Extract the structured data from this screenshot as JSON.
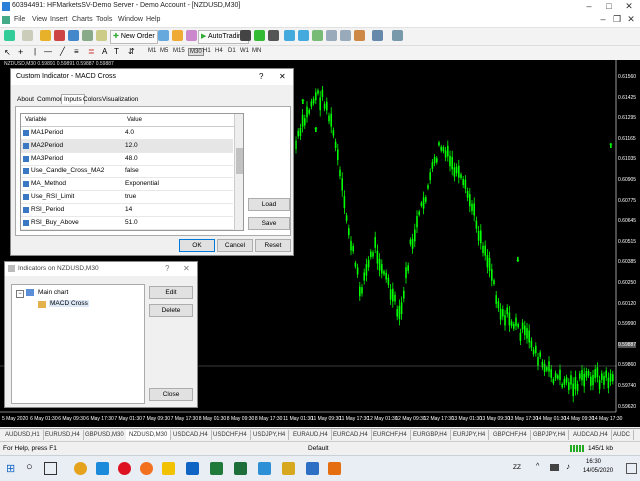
{
  "window": {
    "title": "60394491: HFMarketsSV-Demo Server - Demo Account - [NZDUSD,M30]"
  },
  "menu": [
    "File",
    "View",
    "Insert",
    "Charts",
    "Tools",
    "Window",
    "Help"
  ],
  "toolbar": {
    "new_order": "New Order",
    "autotrading": "AutoTrading"
  },
  "timeframes": [
    "M1",
    "M5",
    "M15",
    "M30",
    "H1",
    "H4",
    "D1",
    "W1",
    "MN"
  ],
  "chart": {
    "title": "NZDUSD,M30  0.59891 0.59891 0.59887 0.59887",
    "prices": [
      "0.61560",
      "0.61425",
      "0.61295",
      "0.61165",
      "0.61035",
      "0.60905",
      "0.60775",
      "0.60645",
      "0.60515",
      "0.60385",
      "0.60250",
      "0.60120",
      "0.59990",
      "0.59887",
      "0.59860",
      "0.59740",
      "0.59620"
    ],
    "times": [
      "5 May 2020",
      "6 May 01:30",
      "6 May 09:30",
      "6 May 17:30",
      "7 May 01:30",
      "7 May 09:30",
      "7 May 17:30",
      "8 May 01:30",
      "8 May 09:30",
      "8 May 17:30",
      "11 May 01:30",
      "11 May 09:30",
      "11 May 17:30",
      "12 May 01:30",
      "12 May 09:30",
      "12 May 17:30",
      "13 May 01:30",
      "13 May 09:30",
      "13 May 17:30",
      "14 May 01:30",
      "14 May 09:30",
      "14 May 17:30"
    ],
    "candle_color": "#00ff00",
    "arrow_color": "#00ff00"
  },
  "custom_dialog": {
    "title": "Custom Indicator - MACD Cross",
    "tabs": [
      "About",
      "Common",
      "Inputs",
      "Colors",
      "Visualization"
    ],
    "active_tab": "Inputs",
    "col_variable": "Variable",
    "col_value": "Value",
    "rows": [
      {
        "name": "MA1Period",
        "value": "4.0"
      },
      {
        "name": "MA2Period",
        "value": "12.0"
      },
      {
        "name": "MA3Period",
        "value": "48.0"
      },
      {
        "name": "Use_Candle_Cross_MA2",
        "value": "false"
      },
      {
        "name": "MA_Method",
        "value": "Exponential"
      },
      {
        "name": "Use_RSI_Limit",
        "value": "true"
      },
      {
        "name": "RSI_Period",
        "value": "14"
      },
      {
        "name": "RSI_Buy_Above",
        "value": "51.0"
      }
    ],
    "load": "Load",
    "save": "Save",
    "ok": "OK",
    "cancel": "Cancel",
    "reset": "Reset"
  },
  "indicators_dialog": {
    "title": "Indicators on NZDUSD,M30",
    "tree_root": "Main chart",
    "tree_child": "MACD Cross",
    "edit": "Edit",
    "delete": "Delete",
    "close": "Close"
  },
  "symbol_tabs": [
    "AUDUSD,H1",
    "EURUSD,H4",
    "GBPUSD,M30",
    "NZDUSD,M30",
    "USDCAD,H4",
    "USDCHF,H4",
    "USDJPY,H4",
    "EURAUD,H4",
    "EURCAD,H4",
    "EURCHF,H4",
    "EURGBP,H4",
    "EURJPY,H4",
    "GBPCHF,H4",
    "GBPJPY,H4",
    "AUDCAD,H4",
    "AUDC"
  ],
  "active_symbol": "NZDUSD,M30",
  "status": {
    "help": "For Help, press F1",
    "profile": "Default",
    "traffic": "145/1 kb"
  },
  "taskbar": {
    "time": "16:30",
    "date": "14/05/2020",
    "lang": "ZZ"
  }
}
